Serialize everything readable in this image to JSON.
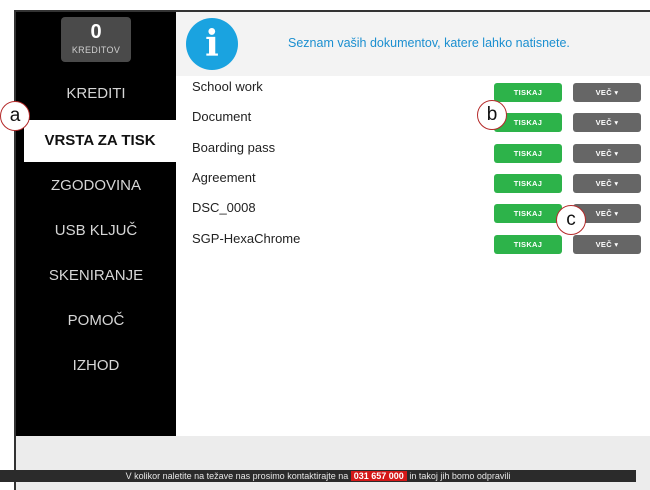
{
  "credits": {
    "value": "0",
    "label": "KREDITOV"
  },
  "nav": [
    {
      "label": "KREDITI",
      "active": false
    },
    {
      "label": "VRSTA ZA TISK",
      "active": true
    },
    {
      "label": "ZGODOVINA",
      "active": false
    },
    {
      "label": "USB KLJUČ",
      "active": false
    },
    {
      "label": "SKENIRANJE",
      "active": false
    },
    {
      "label": "POMOČ",
      "active": false
    },
    {
      "label": "IZHOD",
      "active": false
    }
  ],
  "header": {
    "message": "Seznam vaših dokumentov, katere lahko natisnete.",
    "icon": "info-icon"
  },
  "buttons": {
    "print_label": "TISKAJ",
    "more_label": "VEČ ▾"
  },
  "documents": [
    {
      "name": "School work"
    },
    {
      "name": "Document"
    },
    {
      "name": "Boarding pass"
    },
    {
      "name": "Agreement"
    },
    {
      "name": "DSC_0008"
    },
    {
      "name": "SGP-HexaChrome"
    }
  ],
  "footer": {
    "text_before": "V kolikor naletite na težave nas prosimo kontaktirajte na",
    "phone": "031 657 000",
    "text_after": "in takoj jih bomo odpravili"
  },
  "callouts": {
    "a": "a",
    "b": "b",
    "c": "c"
  },
  "colors": {
    "print_button": "#2db34a",
    "more_button": "#666666",
    "info": "#1aa3e0",
    "sidebar": "#000000"
  }
}
